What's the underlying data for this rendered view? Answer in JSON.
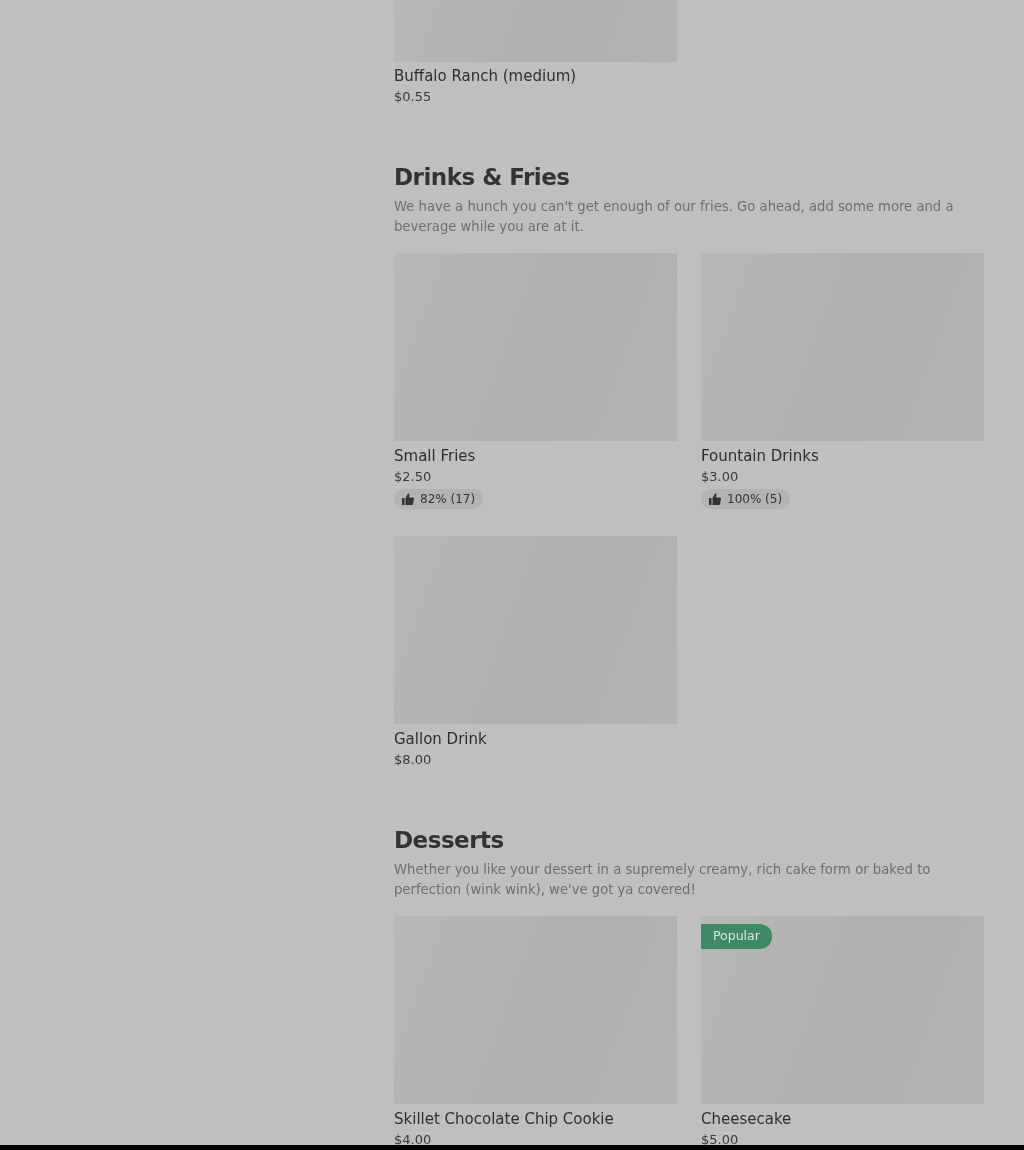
{
  "top_item": {
    "name": "Buffalo Ranch (medium)",
    "price": "$0.55"
  },
  "sections": [
    {
      "title": "Drinks & Fries",
      "description": "We have a hunch you can't get enough of our fries. Go ahead, add some more and a beverage while you are at it.",
      "items": [
        {
          "name": "Small Fries",
          "price": "$2.50",
          "rating": "82% (17)"
        },
        {
          "name": "Fountain Drinks",
          "price": "$3.00",
          "rating": "100% (5)"
        },
        {
          "name": "Gallon Drink",
          "price": "$8.00"
        }
      ]
    },
    {
      "title": "Desserts",
      "description": "Whether you like your dessert in a supremely creamy, rich cake form or baked to perfection (wink wink), we've got ya covered!",
      "items": [
        {
          "name": "Skillet Chocolate Chip Cookie",
          "price": "$4.00"
        },
        {
          "name": "Cheesecake",
          "price": "$5.00",
          "badge": "Popular"
        }
      ]
    }
  ]
}
